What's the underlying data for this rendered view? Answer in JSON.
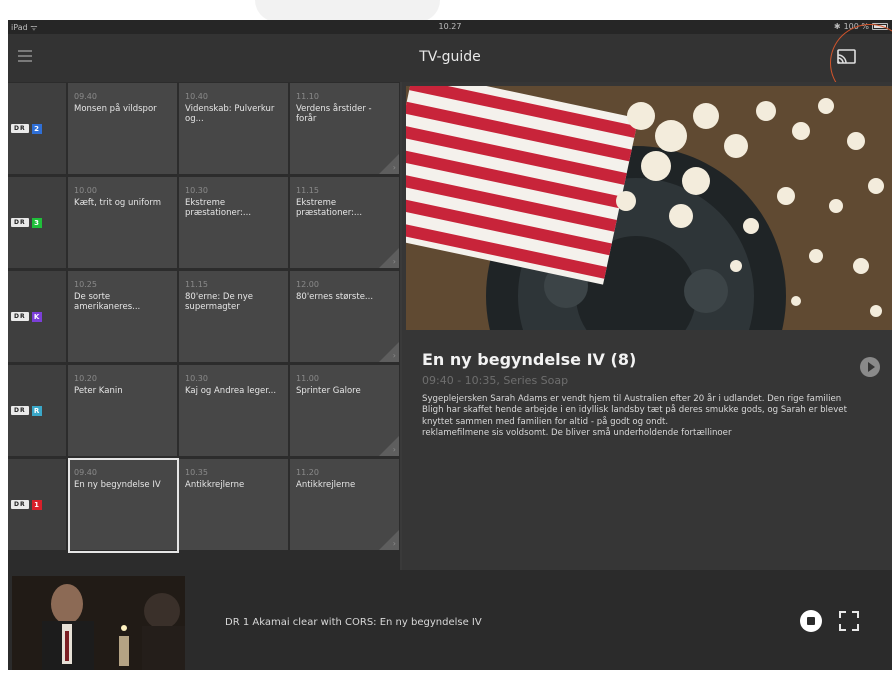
{
  "status_bar": {
    "device": "iPad",
    "time": "10.27",
    "battery": "100 %"
  },
  "header": {
    "title": "TV-guide"
  },
  "colors": {
    "accent_circle": "#d2542b",
    "background": "#3a3a3a"
  },
  "guide": {
    "rows": [
      {
        "channel": "DR 2",
        "chip_color": "#2f6fd6",
        "chip": "2",
        "programs": [
          {
            "time": "09.40",
            "title": "Monsen på vildspor"
          },
          {
            "time": "10.40",
            "title": "Videnskab: Pulverkur og..."
          },
          {
            "time": "11.10",
            "title": "Verdens årstider - forår"
          }
        ]
      },
      {
        "channel": "DR 3",
        "chip_color": "#1fbf3a",
        "chip": "3",
        "programs": [
          {
            "time": "10.00",
            "title": "Kæft, trit og uniform"
          },
          {
            "time": "10.30",
            "title": "Ekstreme præstationer:..."
          },
          {
            "time": "11.15",
            "title": "Ekstreme præstationer:..."
          }
        ]
      },
      {
        "channel": "DR K",
        "chip_color": "#7b3fd8",
        "chip": "K",
        "programs": [
          {
            "time": "10.25",
            "title": "De sorte amerikaneres..."
          },
          {
            "time": "11.15",
            "title": "80'erne: De nye supermagter"
          },
          {
            "time": "12.00",
            "title": "80'ernes største..."
          }
        ]
      },
      {
        "channel": "DR Ramasjang",
        "chip_color": "#3aa8c9",
        "chip": "R",
        "programs": [
          {
            "time": "10.20",
            "title": "Peter Kanin"
          },
          {
            "time": "10.30",
            "title": "Kaj og Andrea leger..."
          },
          {
            "time": "11.00",
            "title": "Sprinter Galore"
          }
        ]
      },
      {
        "channel": "DR 1",
        "chip_color": "#d8202a",
        "chip": "1",
        "programs": [
          {
            "time": "09.40",
            "title": "En ny begyndelse IV"
          },
          {
            "time": "10.35",
            "title": "Antikkrejlerne"
          },
          {
            "time": "11.20",
            "title": "Antikkrejlerne"
          }
        ]
      }
    ]
  },
  "detail": {
    "title": "En ny begyndelse IV (8)",
    "meta": "09:40 - 10:35, Series Soap",
    "description_1": "Sygeplejersken Sarah Adams er vendt hjem til Australien efter 20 år i udlandet. Den rige familien Bligh har skaffet hende arbejde i en idyllisk landsby tæt på deres smukke gods, og Sarah er blevet knyttet sammen med familien for altid - på godt og ondt.",
    "description_2": "reklamefilmene sis voldsomt. De bliver små underholdende fortællinoer"
  },
  "player": {
    "now_playing": "DR 1 Akamai clear with CORS: En ny begyndelse IV"
  }
}
